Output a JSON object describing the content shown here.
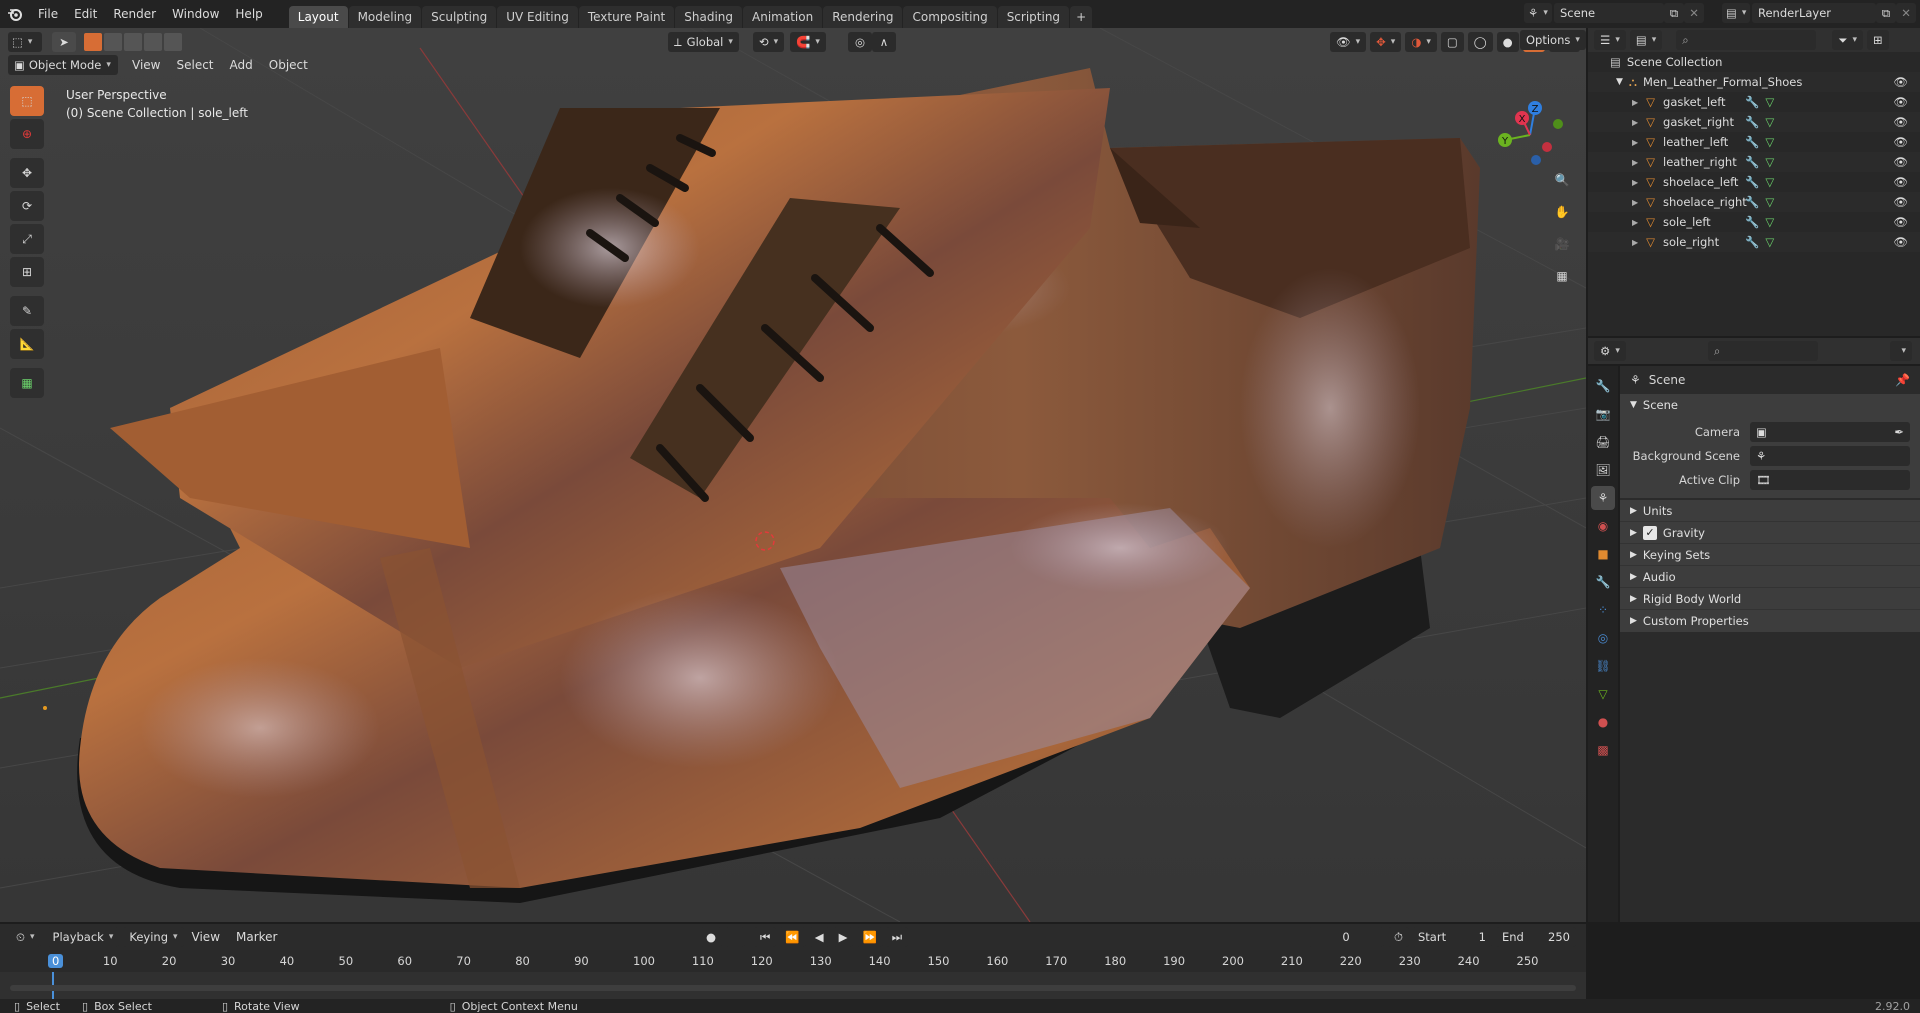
{
  "topbar": {
    "menus": [
      "File",
      "Edit",
      "Render",
      "Window",
      "Help"
    ],
    "workspaces": [
      "Layout",
      "Modeling",
      "Sculpting",
      "UV Editing",
      "Texture Paint",
      "Shading",
      "Animation",
      "Rendering",
      "Compositing",
      "Scripting"
    ],
    "active_workspace": "Layout",
    "add_tab": "+",
    "scene_name": "Scene",
    "view_layer": "RenderLayer"
  },
  "viewport": {
    "mode": "Object Mode",
    "menus": [
      "View",
      "Select",
      "Add",
      "Object"
    ],
    "orientation": "Global",
    "options_label": "Options",
    "overlay_title": "User Perspective",
    "overlay_subtitle": "(0) Scene Collection | sole_left",
    "gizmo_axes": {
      "x": "X",
      "y": "Y",
      "z": "Z"
    },
    "colors": {
      "x": "#e0344f",
      "y": "#6bb320",
      "z": "#2f7fe0",
      "active_tool": "#d76d35"
    }
  },
  "outliner": {
    "root": "Scene Collection",
    "collection": "Men_Leather_Formal_Shoes",
    "objects": [
      "gasket_left",
      "gasket_right",
      "leather_left",
      "leather_right",
      "shoelace_left",
      "shoelace_right",
      "sole_left",
      "sole_right"
    ]
  },
  "properties": {
    "context_title": "Scene",
    "panel_title": "Scene",
    "fields": [
      {
        "label": "Camera",
        "value": ""
      },
      {
        "label": "Background Scene",
        "value": ""
      },
      {
        "label": "Active Clip",
        "value": ""
      }
    ],
    "subpanels": [
      "Units",
      "Gravity",
      "Keying Sets",
      "Audio",
      "Rigid Body World",
      "Custom Properties"
    ],
    "gravity_checked": true
  },
  "timeline": {
    "menus": [
      "Playback",
      "Keying",
      "View",
      "Marker"
    ],
    "current_frame": "0",
    "start_label": "Start",
    "start_value": "1",
    "end_label": "End",
    "end_value": "250",
    "ruler": [
      "0",
      "10",
      "20",
      "30",
      "40",
      "50",
      "60",
      "70",
      "80",
      "90",
      "100",
      "110",
      "120",
      "130",
      "140",
      "150",
      "160",
      "170",
      "180",
      "190",
      "200",
      "210",
      "220",
      "230",
      "240",
      "250"
    ]
  },
  "statusbar": {
    "select": "Select",
    "box_select": "Box Select",
    "rotate_view": "Rotate View",
    "context_menu": "Object Context Menu",
    "version": "2.92.0"
  }
}
